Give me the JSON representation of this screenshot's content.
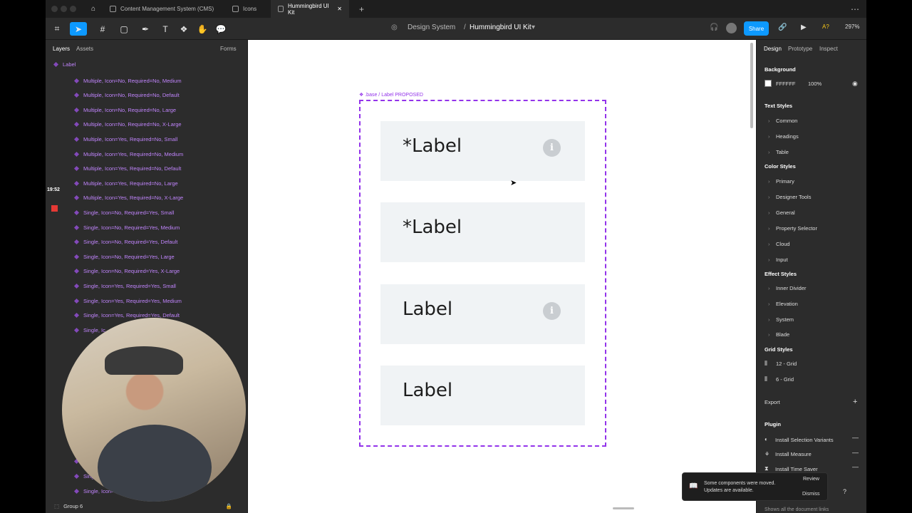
{
  "tabs": [
    {
      "label": "Content Management System (CMS)"
    },
    {
      "label": "Icons"
    },
    {
      "label": "Hummingbird UI Kit"
    }
  ],
  "toolbar": {
    "breadcrumb_project": "Design System",
    "breadcrumb_sep": "/",
    "breadcrumb_file": "Hummingbird UI Kit",
    "share_label": "Share",
    "zoom": "297%",
    "ai_label": "A?"
  },
  "left_panel": {
    "tab_layers": "Layers",
    "tab_assets": "Assets",
    "page_select": "Forms",
    "root_layer": "Label",
    "timestamp": "19:52",
    "layers": [
      "Multiple, Icon=No, Required=No, Medium",
      "Multiple, Icon=No, Required=No, Default",
      "Multiple, Icon=No, Required=No, Large",
      "Multiple, Icon=No, Required=No, X-Large",
      "Multiple, Icon=Yes, Required=No, Small",
      "Multiple, Icon=Yes, Required=No, Medium",
      "Multiple, Icon=Yes, Required=No, Default",
      "Multiple, Icon=Yes, Required=No, Large",
      "Multiple, Icon=Yes, Required=No, X-Large",
      "Single, Icon=No, Required=Yes, Small",
      "Single, Icon=No, Required=Yes, Medium",
      "Single, Icon=No, Required=Yes, Default",
      "Single, Icon=No, Required=Yes, Large",
      "Single, Icon=No, Required=Yes, X-Large",
      "Single, Icon=Yes, Required=Yes, Small",
      "Single, Icon=Yes, Required=Yes, Medium",
      "Single, Icon=Yes, Required=Yes, Default",
      "Single, Ic"
    ],
    "bottom_layers": [
      "Si",
      "Single, I",
      "Single, Icon=Yes,"
    ],
    "footer_layer": "Group 6"
  },
  "canvas": {
    "frame_label": ".base / Label PROPOSED",
    "cards": [
      {
        "text": "*Label",
        "has_info": true
      },
      {
        "text": "*Label",
        "has_info": false
      },
      {
        "text": "Label",
        "has_info": true
      },
      {
        "text": "Label",
        "has_info": false
      }
    ],
    "info_glyph": "i"
  },
  "right_panel": {
    "tab_design": "Design",
    "tab_prototype": "Prototype",
    "tab_inspect": "Inspect",
    "background_title": "Background",
    "background_hex": "FFFFFF",
    "background_opacity": "100%",
    "text_styles_title": "Text Styles",
    "text_styles": [
      "Common",
      "Headings",
      "Table"
    ],
    "color_styles_title": "Color Styles",
    "color_styles": [
      "Primary",
      "Designer Tools",
      "General",
      "Property Selector",
      "Cloud",
      "Input"
    ],
    "effect_styles_title": "Effect Styles",
    "effect_styles": [
      "Inner Divider",
      "Elevation",
      "System",
      "Blade"
    ],
    "grid_styles_title": "Grid Styles",
    "grid_styles": [
      "12 - Grid",
      "6 - Grid"
    ],
    "export_title": "Export",
    "plugin_title": "Plugin",
    "plugins": [
      "Install Selection Variants",
      "Install Measure",
      "Install Time Saver"
    ],
    "footer_hint": "Shows all the document links"
  },
  "toast": {
    "message": "Some components were moved. Updates are available.",
    "review": "Review",
    "dismiss": "Dismiss"
  },
  "colors": {
    "accent": "#0d99ff",
    "component_purple": "#9333ea",
    "canvas_bg": "#ffffff"
  }
}
